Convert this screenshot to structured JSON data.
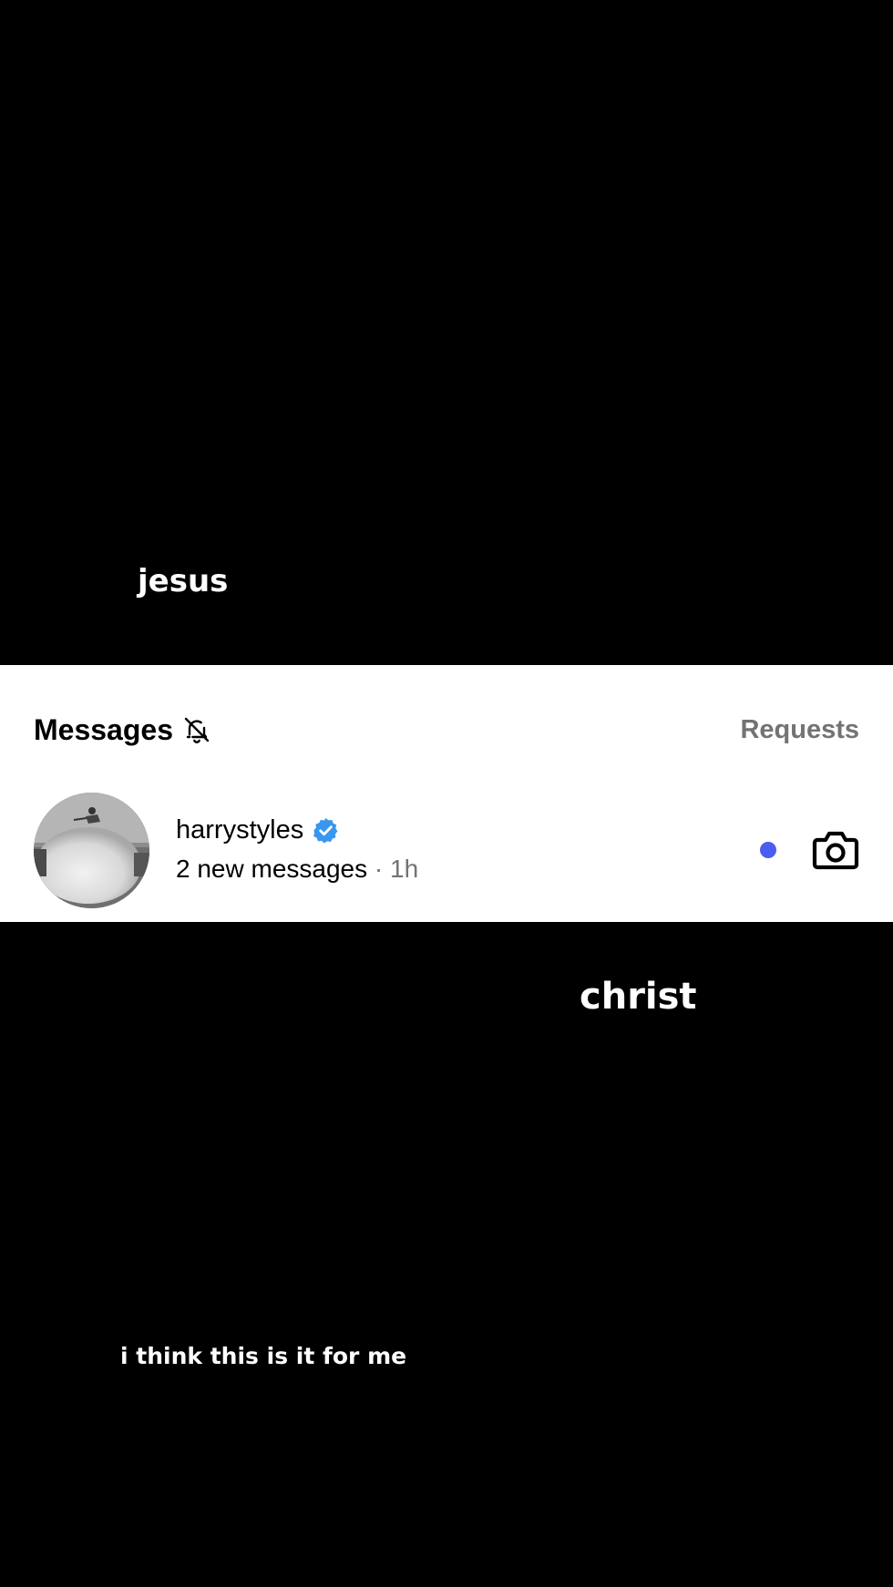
{
  "captions": {
    "top": "jesus",
    "middle": "christ",
    "bottom": "i think this is it for me"
  },
  "messages_panel": {
    "title": "Messages",
    "muted_icon": "bell-off-icon",
    "requests_label": "Requests",
    "thread": {
      "username": "harrystyles",
      "verified_icon": "verified-badge-icon",
      "preview": "2 new messages",
      "separator": "·",
      "time": "1h",
      "unread": true,
      "action_icon": "camera-icon"
    }
  },
  "colors": {
    "background": "#000000",
    "panel": "#ffffff",
    "muted_text": "#737373",
    "verified_blue": "#3897f0",
    "unread_dot": "#4a5df0"
  }
}
